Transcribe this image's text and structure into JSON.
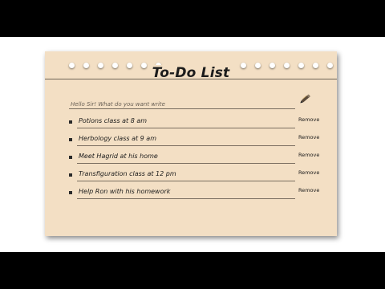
{
  "card": {
    "title": "To-Do List",
    "input_placeholder": "Hello Sir! What do you want write",
    "pen_icon": "pen-icon"
  },
  "todos": [
    {
      "text": "Potions class at 8 am",
      "remove_label": "Remove"
    },
    {
      "text": "Herbology class at 9 am",
      "remove_label": "Remove"
    },
    {
      "text": "Meet Hagrid at his home",
      "remove_label": "Remove"
    },
    {
      "text": "Transfiguration class at 12 pm",
      "remove_label": "Remove"
    },
    {
      "text": "Help Ron with his homework",
      "remove_label": "Remove"
    }
  ],
  "colors": {
    "card_background": "#f3dfc4",
    "letterbox": "#000000",
    "stage": "#ffffff"
  }
}
